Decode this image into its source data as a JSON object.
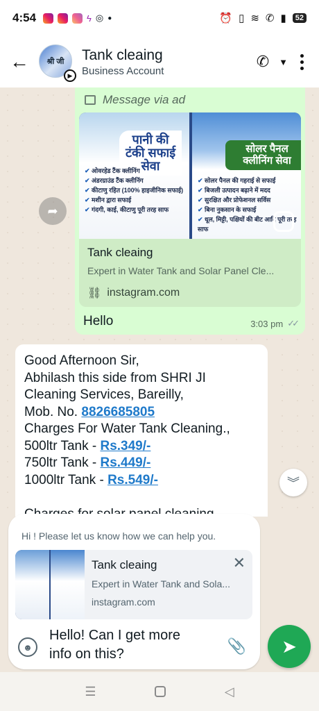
{
  "status_bar": {
    "time": "4:54",
    "battery": "52",
    "notification_icons": [
      "instagram-icon",
      "instagram-icon",
      "instagram-icon",
      "messenger-icon",
      "threads-icon"
    ],
    "system_icons": [
      "alarm-icon",
      "vibrate-icon",
      "wifi-icon",
      "call-icon",
      "signal-icon",
      "battery-icon"
    ]
  },
  "header": {
    "name": "Tank cleaing",
    "subtitle": "Business Account",
    "avatar_text": "श्री जी"
  },
  "chat": {
    "ad_label": "Message via ad",
    "link_card": {
      "image_left_title": "पानी की टंकी सफाई सेवा",
      "image_left_points": [
        "ओवरहेड टैंक क्लीनिंग",
        "अंडरग्राउंड टैंक क्लीनिंग",
        "कीटाणु रहित (100% हाइजीनिक सफाई)",
        "मशीन द्वारा सफाई",
        "गंदगी, काई, कीटाणु पूरी तरह साफ"
      ],
      "image_right_title": "सोलर पैनल क्लीनिंग सेवा",
      "image_right_points": [
        "सोलर पैनल की गहराई से सफाई",
        "बिजली उत्पादन बढ़ाने में मदद",
        "सुरक्षित और प्रोफेशनल सर्विस",
        "बिना नुकसान के सफाई",
        "धूल, मिट्टी, पक्षियों की बीट आदि पूरी तरह साफ"
      ],
      "title": "Tank cleaing",
      "description": "Expert in Water Tank and Solar Panel Cle...",
      "domain": "instagram.com"
    },
    "outgoing_message": {
      "text": "Hello",
      "time": "3:03 pm"
    },
    "incoming_message": {
      "line1": "Good Afternoon Sir,",
      "line2": "Abhilash this side from SHRI JI",
      "line3": "Cleaning Services,  Bareilly,",
      "line4_prefix": "Mob. No. ",
      "phone": "8826685805",
      "line5": "Charges For Water Tank Cleaning.,",
      "tank1_prefix": "500ltr Tank - ",
      "tank1_price": "Rs.349/-",
      "tank2_prefix": "750ltr Tank - ",
      "tank2_price": "Rs.449/-",
      "tank3_prefix": "1000ltr Tank - ",
      "tank3_price": "Rs.549/-",
      "line_partial": "Charges for solar panel cleaning"
    }
  },
  "composer": {
    "hint": "Hi ! Please let us know how we can help you.",
    "preview": {
      "title": "Tank cleaing",
      "description": "Expert in Water Tank and Sola...",
      "domain": "instagram.com"
    },
    "text_line1": "Hello! Can I get more",
    "text_line2": "info on this?"
  },
  "colors": {
    "outgoing_bubble": "#d9fdd3",
    "incoming_bubble": "#ffffff",
    "chat_bg": "#efe7dd",
    "send_button": "#1fa855",
    "link": "#1f7aca"
  }
}
